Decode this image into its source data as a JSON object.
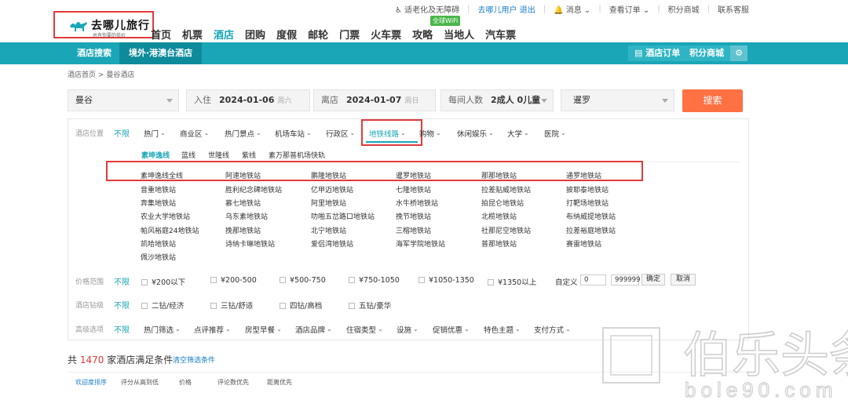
{
  "util": {
    "accessibility": "适老化及无障碍",
    "user": "去哪儿用户",
    "logout": "退出",
    "messages": "消息",
    "orders": "查看订单",
    "points": "积分商城",
    "service": "联系客服"
  },
  "logo": {
    "brand": "去哪儿旅行",
    "slogan": "总有你要的低价"
  },
  "mainnav": [
    "首页",
    "机票",
    "酒店",
    "团购",
    "度假",
    "邮轮",
    "门票",
    "火车票",
    "攻略",
    "当地人",
    "汽车票"
  ],
  "wifi_badge": "全球WiFi",
  "subnav": {
    "tab1": "酒店搜索",
    "tab2": "境外·港澳台酒店",
    "hotel_orders": "酒店订单",
    "points_mall": "积分商城"
  },
  "breadcrumb": {
    "home": "酒店首页",
    "sep": ">",
    "current": "曼谷酒店"
  },
  "search": {
    "city": "曼谷",
    "checkin_label": "入住",
    "checkin": "2024-01-06",
    "checkin_week": "周六",
    "checkout_label": "离店",
    "checkout": "2024-01-07",
    "checkout_week": "周日",
    "guests_label": "每间人数",
    "guests": "2成人 0儿童",
    "country": "暹罗",
    "button": "搜索"
  },
  "location": {
    "label": "酒店位置",
    "unlimited": "不限",
    "filters": [
      "热门",
      "商业区",
      "热门景点",
      "机场车站",
      "行政区",
      "地铁线路",
      "购物",
      "休闲娱乐",
      "大学",
      "医院"
    ],
    "metro_lines": [
      "素坤逸线",
      "蓝线",
      "世隆线",
      "紫线",
      "素万那普机场快轨"
    ],
    "stations": [
      [
        "素坤逸线全线",
        "阿速地铁站",
        "鹏隆地铁站",
        "暹罗地铁站",
        "那那地铁站",
        "通罗地铁站"
      ],
      [
        "音重地铁站",
        "胜利纪念碑地铁站",
        "亿甲迈地铁站",
        "七隆地铁站",
        "拉差贴威地铁站",
        "披耶泰地铁站"
      ],
      [
        "奔集地铁站",
        "慕七地铁站",
        "阿里地铁站",
        "水牛桥地铁站",
        "拍昆仑地铁站",
        "打靶场地铁站"
      ],
      [
        "农业大学地铁站",
        "乌东素地铁站",
        "叻啪五岔路口地铁站",
        "挽节地铁站",
        "北榄地铁站",
        "布纳威提地铁站"
      ],
      [
        "帕风裕庭24地铁站",
        "挽那地铁站",
        "北宁地铁站",
        "三榕地铁站",
        "社那尼空地铁站",
        "拉差裕庭地铁站"
      ],
      [
        "凯哈地铁站",
        "诗纳卡琳地铁站",
        "爱侣湾地铁站",
        "海军学院地铁站",
        "普那地铁站",
        "赛雷地铁站"
      ],
      [
        "佩沙地铁站"
      ]
    ]
  },
  "price": {
    "label": "价格范围",
    "unlimited": "不限",
    "options": [
      "¥200以下",
      "¥200-500",
      "¥500-750",
      "¥750-1050",
      "¥1050-1350",
      "¥1350以上"
    ],
    "custom_label": "自定义",
    "min": "0",
    "max": "999999",
    "confirm": "确定",
    "cancel": "取消"
  },
  "stars": {
    "label": "酒店钻级",
    "unlimited": "不限",
    "options": [
      "二钻/经济",
      "三钻/舒适",
      "四钻/高档",
      "五钻/豪华"
    ]
  },
  "advanced": {
    "label": "高级选项",
    "unlimited": "不限",
    "options": [
      "热门筛选",
      "点评推荐",
      "房型早餐",
      "酒店品牌",
      "住宿类型",
      "设施",
      "促销优惠",
      "特色主题",
      "支付方式"
    ]
  },
  "results": {
    "prefix": "共",
    "count": "1470",
    "suffix": "家酒店满足条件",
    "clear": "清空筛选条件"
  },
  "sort": [
    "欢迎度排序",
    "评分从高到低",
    "价格",
    "评论数优先",
    "距离优先"
  ],
  "watermark": {
    "text": "伯乐头条",
    "url": "bole90.com"
  },
  "colors": {
    "teal": "#1aa6b7",
    "search_button": "#ff7043",
    "highlight_box": "#e23a3a",
    "price_count": "#e23a3a"
  }
}
